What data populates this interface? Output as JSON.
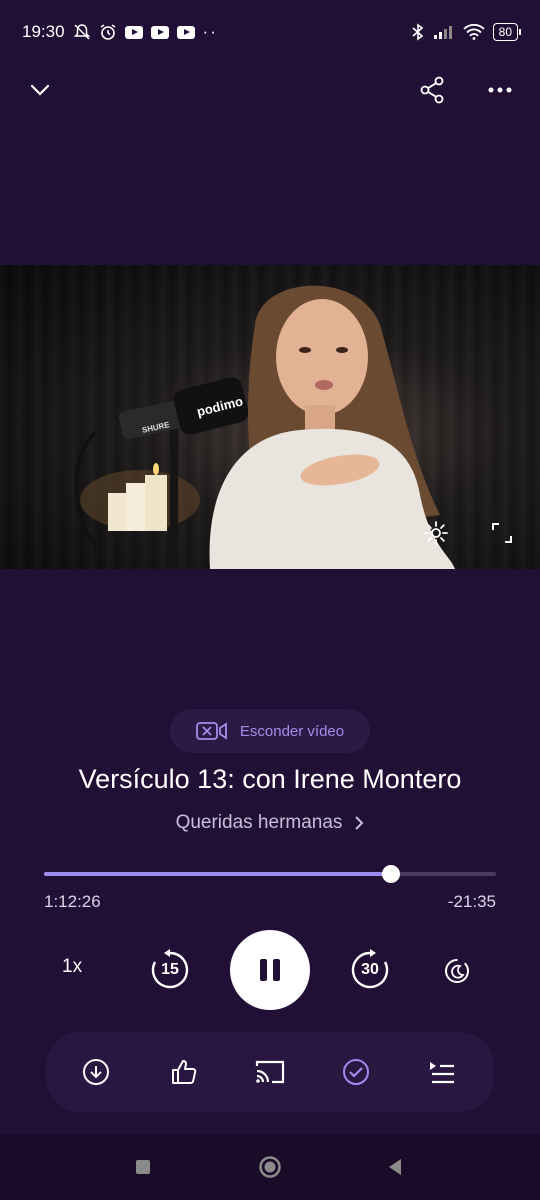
{
  "status_bar": {
    "time": "19:30",
    "battery": "80"
  },
  "colors": {
    "background": "#220f35",
    "accent": "#9e8bef",
    "accent_text": "#a58de9",
    "card": "#291641"
  },
  "top_bar": {
    "icons": [
      "chevron-down-icon",
      "share-icon",
      "more-icon"
    ]
  },
  "video": {
    "mic_brand": "podimo",
    "mic_maker": "SHURE"
  },
  "hide_video": {
    "label": "Esconder vídeo"
  },
  "episode": {
    "title": "Versículo 13: con Irene Montero",
    "show": "Queridas hermanas"
  },
  "progress": {
    "fraction": 0.767,
    "elapsed": "1:12:26",
    "remaining": "-21:35"
  },
  "controls": {
    "speed": "1x",
    "rewind_seconds": "15",
    "forward_seconds": "30"
  },
  "actions": {
    "icons": [
      "download-icon",
      "thumbs-up-icon",
      "cast-icon",
      "check-circle-icon",
      "queue-icon"
    ]
  },
  "nav": {
    "icons": [
      "recents-icon",
      "home-icon",
      "back-icon"
    ]
  }
}
